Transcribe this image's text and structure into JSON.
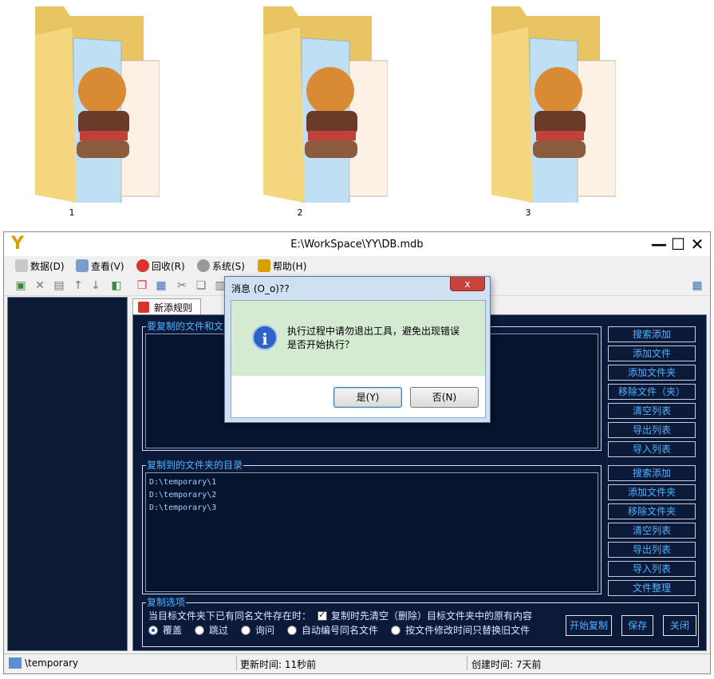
{
  "desktop": {
    "folders": [
      {
        "label": "1"
      },
      {
        "label": "2"
      },
      {
        "label": "3"
      }
    ]
  },
  "window": {
    "title": "E:\\WorkSpace\\YY\\DB.mdb",
    "controls": {
      "minimize": "—",
      "maximize": "☐",
      "close": "✕"
    }
  },
  "menu": {
    "items": [
      {
        "label": "数据(D)",
        "icon": "database-icon"
      },
      {
        "label": "查看(V)",
        "icon": "view-icon"
      },
      {
        "label": "回收(R)",
        "icon": "lifebuoy-icon"
      },
      {
        "label": "系统(S)",
        "icon": "gear-icon"
      },
      {
        "label": "帮助(H)",
        "icon": "help-icon"
      }
    ]
  },
  "tab": {
    "label": "新添规则"
  },
  "source_group": {
    "legend": "要复制的文件和文"
  },
  "dest_group": {
    "legend": "复制到的文件夹的目录",
    "paths": [
      "D:\\temporary\\1",
      "D:\\temporary\\2",
      "D:\\temporary\\3"
    ]
  },
  "source_buttons": [
    "搜索添加",
    "添加文件",
    "添加文件夹",
    "移除文件（夹）",
    "清空列表",
    "导出列表",
    "导入列表"
  ],
  "dest_buttons": [
    "搜索添加",
    "添加文件夹",
    "移除文件夹",
    "清空列表",
    "导出列表",
    "导入列表",
    "文件整理"
  ],
  "options": {
    "legend": "复制选项",
    "prompt": "当目标文件夹下已有同名文件存在时：",
    "clear_first": "复制时先清空（删除）目标文件夹中的原有内容",
    "radios": [
      "覆盖",
      "跳过",
      "询问",
      "自动编号同名文件",
      "按文件修改时间只替换旧文件"
    ],
    "selected": "覆盖"
  },
  "actions": {
    "start": "开始复制",
    "save": "保存",
    "close": "关闭"
  },
  "status": {
    "path": "\\temporary",
    "updated": "更新时间: 11秒前",
    "created": "创建时间: 7天前"
  },
  "dialog": {
    "title": "消息 (O_o)??",
    "close_label": "x",
    "message_line1": "执行过程中请勿退出工具，避免出现错误",
    "message_line2": "是否开始执行？",
    "yes": "是(Y)",
    "no": "否(N)"
  }
}
